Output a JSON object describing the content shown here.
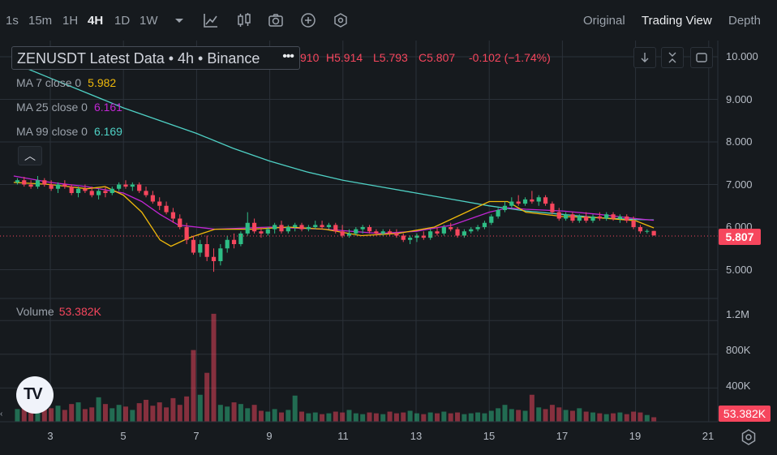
{
  "timeframes": [
    "1s",
    "15m",
    "1H",
    "4H",
    "1D",
    "1W"
  ],
  "active_timeframe": "4H",
  "views": {
    "original": "Original",
    "trading_view": "Trading View",
    "depth": "Depth"
  },
  "legend": {
    "title": "ZENUSDT Latest Data • 4h • Binance",
    "more": "•••",
    "open_partial": "910",
    "high": "H5.914",
    "low": "L5.793",
    "close": "C5.807",
    "change": "-0.102 (−1.74%)"
  },
  "ma": [
    {
      "label": "MA 7 close 0",
      "value": "5.982",
      "color": "#f0b90b"
    },
    {
      "label": "MA 25 close 0",
      "value": "6.161",
      "color": "#c026d3"
    },
    {
      "label": "MA 99 close 0",
      "value": "6.169",
      "color": "#4fd1c5"
    }
  ],
  "volume": {
    "label": "Volume",
    "value": "53.382K"
  },
  "price_axis": [
    "10.000",
    "9.000",
    "8.000",
    "7.000",
    "6.000",
    "5.000"
  ],
  "volume_axis": [
    "1.2M",
    "800K",
    "400K"
  ],
  "last_price": "5.807",
  "last_volume": "53.382K",
  "x_axis": [
    "3",
    "5",
    "7",
    "9",
    "11",
    "13",
    "15",
    "17",
    "19",
    "21"
  ],
  "colors": {
    "up": "#2ebd85",
    "down": "#f6465d",
    "bg": "#161a1e",
    "grid": "#2b3139"
  },
  "chart_data": {
    "type": "candlestick",
    "symbol": "ZENUSDT",
    "interval": "4h",
    "x_range": [
      2,
      21.5
    ],
    "price_range": [
      4.5,
      10.3
    ],
    "volume_range": [
      0,
      1300000
    ],
    "candles": [
      [
        7.05,
        7.15,
        7.0,
        7.1,
        150000
      ],
      [
        7.1,
        7.18,
        6.95,
        7.0,
        230000
      ],
      [
        7.0,
        7.1,
        6.9,
        6.95,
        180000
      ],
      [
        6.95,
        7.2,
        6.9,
        7.1,
        200000
      ],
      [
        7.1,
        7.15,
        6.95,
        7.0,
        170000
      ],
      [
        7.0,
        7.1,
        6.85,
        6.9,
        160000
      ],
      [
        6.9,
        7.05,
        6.8,
        7.0,
        190000
      ],
      [
        7.0,
        7.1,
        6.9,
        6.95,
        140000
      ],
      [
        6.95,
        7.0,
        6.75,
        6.8,
        210000
      ],
      [
        6.8,
        6.95,
        6.7,
        6.9,
        230000
      ],
      [
        6.9,
        7.0,
        6.8,
        6.85,
        150000
      ],
      [
        6.85,
        6.95,
        6.7,
        6.75,
        170000
      ],
      [
        6.75,
        6.9,
        6.65,
        6.85,
        290000
      ],
      [
        6.85,
        6.95,
        6.7,
        6.8,
        210000
      ],
      [
        6.8,
        6.95,
        6.75,
        6.9,
        160000
      ],
      [
        6.9,
        7.05,
        6.85,
        7.0,
        200000
      ],
      [
        7.0,
        7.1,
        6.9,
        6.95,
        180000
      ],
      [
        6.95,
        7.05,
        6.85,
        7.0,
        140000
      ],
      [
        7.0,
        7.05,
        6.8,
        6.85,
        220000
      ],
      [
        6.85,
        6.95,
        6.7,
        6.75,
        260000
      ],
      [
        6.75,
        6.85,
        6.55,
        6.6,
        190000
      ],
      [
        6.6,
        6.7,
        6.4,
        6.5,
        230000
      ],
      [
        6.5,
        6.6,
        6.3,
        6.35,
        170000
      ],
      [
        6.35,
        6.45,
        6.1,
        6.2,
        280000
      ],
      [
        6.2,
        6.3,
        5.95,
        6.0,
        200000
      ],
      [
        6.0,
        6.1,
        5.6,
        5.7,
        300000
      ],
      [
        5.7,
        5.8,
        5.35,
        5.4,
        850000
      ],
      [
        5.4,
        5.7,
        5.3,
        5.6,
        320000
      ],
      [
        5.6,
        5.8,
        5.2,
        5.3,
        580000
      ],
      [
        5.3,
        5.5,
        4.95,
        5.2,
        1280000
      ],
      [
        5.2,
        5.6,
        5.1,
        5.5,
        200000
      ],
      [
        5.5,
        5.8,
        5.4,
        5.7,
        180000
      ],
      [
        5.7,
        5.85,
        5.5,
        5.6,
        230000
      ],
      [
        5.6,
        5.9,
        5.55,
        5.85,
        210000
      ],
      [
        5.85,
        6.35,
        5.8,
        6.1,
        160000
      ],
      [
        6.1,
        6.2,
        5.85,
        5.9,
        200000
      ],
      [
        5.9,
        6.0,
        5.75,
        5.85,
        130000
      ],
      [
        5.85,
        6.0,
        5.8,
        5.95,
        120000
      ],
      [
        5.95,
        6.1,
        5.85,
        6.05,
        150000
      ],
      [
        6.05,
        6.15,
        5.85,
        5.9,
        110000
      ],
      [
        5.9,
        6.05,
        5.85,
        6.0,
        140000
      ],
      [
        6.0,
        6.1,
        5.9,
        6.05,
        310000
      ],
      [
        6.05,
        6.1,
        5.9,
        5.95,
        120000
      ],
      [
        5.95,
        6.05,
        5.9,
        6.0,
        100000
      ],
      [
        6.0,
        6.15,
        5.95,
        6.05,
        110000
      ],
      [
        6.05,
        6.15,
        5.95,
        6.0,
        90000
      ],
      [
        6.0,
        6.1,
        5.95,
        6.05,
        100000
      ],
      [
        6.05,
        6.1,
        5.85,
        5.9,
        120000
      ],
      [
        5.9,
        6.05,
        5.75,
        5.8,
        110000
      ],
      [
        5.8,
        5.95,
        5.75,
        5.85,
        140000
      ],
      [
        5.85,
        6.0,
        5.8,
        5.95,
        100000
      ],
      [
        5.95,
        6.05,
        5.85,
        6.0,
        90000
      ],
      [
        6.0,
        6.05,
        5.85,
        5.9,
        110000
      ],
      [
        5.9,
        5.95,
        5.8,
        5.85,
        100000
      ],
      [
        5.85,
        5.95,
        5.8,
        5.9,
        90000
      ],
      [
        5.9,
        5.95,
        5.8,
        5.85,
        120000
      ],
      [
        5.85,
        5.95,
        5.75,
        5.8,
        100000
      ],
      [
        5.8,
        5.85,
        5.65,
        5.7,
        110000
      ],
      [
        5.7,
        5.8,
        5.6,
        5.75,
        130000
      ],
      [
        5.75,
        5.85,
        5.65,
        5.8,
        100000
      ],
      [
        5.8,
        5.9,
        5.7,
        5.75,
        90000
      ],
      [
        5.75,
        5.95,
        5.7,
        5.9,
        110000
      ],
      [
        5.9,
        6.0,
        5.8,
        5.85,
        100000
      ],
      [
        5.85,
        6.05,
        5.8,
        6.0,
        120000
      ],
      [
        6.0,
        6.1,
        5.9,
        5.95,
        100000
      ],
      [
        5.95,
        6.0,
        5.75,
        5.8,
        110000
      ],
      [
        5.8,
        5.95,
        5.75,
        5.9,
        90000
      ],
      [
        5.9,
        6.0,
        5.85,
        5.95,
        100000
      ],
      [
        5.95,
        6.05,
        5.9,
        6.0,
        110000
      ],
      [
        6.0,
        6.15,
        5.95,
        6.1,
        100000
      ],
      [
        6.1,
        6.3,
        6.05,
        6.25,
        130000
      ],
      [
        6.25,
        6.45,
        6.2,
        6.4,
        160000
      ],
      [
        6.4,
        6.6,
        6.35,
        6.5,
        200000
      ],
      [
        6.5,
        6.7,
        6.45,
        6.6,
        150000
      ],
      [
        6.6,
        6.75,
        6.5,
        6.55,
        140000
      ],
      [
        6.55,
        6.7,
        6.5,
        6.65,
        130000
      ],
      [
        6.65,
        6.85,
        6.55,
        6.6,
        320000
      ],
      [
        6.6,
        6.75,
        6.5,
        6.7,
        170000
      ],
      [
        6.7,
        6.75,
        6.5,
        6.55,
        150000
      ],
      [
        6.55,
        6.6,
        6.3,
        6.35,
        200000
      ],
      [
        6.35,
        6.45,
        6.15,
        6.2,
        170000
      ],
      [
        6.2,
        6.35,
        6.15,
        6.3,
        140000
      ],
      [
        6.3,
        6.35,
        6.1,
        6.15,
        130000
      ],
      [
        6.15,
        6.3,
        6.1,
        6.25,
        160000
      ],
      [
        6.25,
        6.35,
        6.1,
        6.15,
        120000
      ],
      [
        6.15,
        6.3,
        6.1,
        6.25,
        110000
      ],
      [
        6.25,
        6.35,
        6.15,
        6.2,
        100000
      ],
      [
        6.2,
        6.35,
        6.15,
        6.3,
        90000
      ],
      [
        6.3,
        6.35,
        6.15,
        6.2,
        100000
      ],
      [
        6.2,
        6.3,
        6.1,
        6.25,
        110000
      ],
      [
        6.25,
        6.3,
        6.1,
        6.15,
        90000
      ],
      [
        6.15,
        6.25,
        5.95,
        6.0,
        120000
      ],
      [
        6.0,
        6.05,
        5.85,
        5.9,
        110000
      ],
      [
        5.9,
        5.95,
        5.85,
        5.91,
        80000
      ],
      [
        5.91,
        5.914,
        5.793,
        5.807,
        53382
      ]
    ],
    "ma7": [
      [
        2,
        7.05
      ],
      [
        3,
        7.0
      ],
      [
        4,
        6.9
      ],
      [
        4.5,
        6.95
      ],
      [
        5,
        6.75
      ],
      [
        5.5,
        6.35
      ],
      [
        6,
        5.7
      ],
      [
        6.3,
        5.55
      ],
      [
        6.8,
        5.75
      ],
      [
        7.5,
        5.95
      ],
      [
        8.5,
        5.95
      ],
      [
        9.5,
        6.0
      ],
      [
        10.5,
        5.95
      ],
      [
        11.5,
        5.8
      ],
      [
        12.5,
        5.85
      ],
      [
        13.5,
        6.0
      ],
      [
        14.5,
        6.4
      ],
      [
        15,
        6.6
      ],
      [
        15.5,
        6.6
      ],
      [
        16,
        6.35
      ],
      [
        17,
        6.25
      ],
      [
        18,
        6.22
      ],
      [
        19,
        6.15
      ],
      [
        19.5,
        5.98
      ]
    ],
    "ma25": [
      [
        2,
        7.2
      ],
      [
        3,
        7.05
      ],
      [
        4,
        6.95
      ],
      [
        5,
        6.8
      ],
      [
        5.5,
        6.6
      ],
      [
        6,
        6.3
      ],
      [
        6.5,
        6.05
      ],
      [
        7.5,
        5.95
      ],
      [
        9,
        6.0
      ],
      [
        10.5,
        5.95
      ],
      [
        12,
        5.85
      ],
      [
        13,
        5.9
      ],
      [
        14,
        6.05
      ],
      [
        15,
        6.35
      ],
      [
        15.5,
        6.45
      ],
      [
        16,
        6.42
      ],
      [
        17,
        6.38
      ],
      [
        18,
        6.3
      ],
      [
        19,
        6.2
      ],
      [
        19.5,
        6.16
      ]
    ],
    "ma99": [
      [
        2,
        9.85
      ],
      [
        3,
        9.5
      ],
      [
        4,
        9.15
      ],
      [
        5,
        8.8
      ],
      [
        6,
        8.5
      ],
      [
        7,
        8.2
      ],
      [
        8,
        7.85
      ],
      [
        9,
        7.55
      ],
      [
        10,
        7.3
      ],
      [
        11,
        7.1
      ],
      [
        12,
        6.95
      ],
      [
        13,
        6.8
      ],
      [
        14,
        6.65
      ],
      [
        15,
        6.5
      ],
      [
        16,
        6.38
      ],
      [
        17,
        6.3
      ],
      [
        18,
        6.22
      ],
      [
        19,
        6.18
      ],
      [
        19.5,
        6.17
      ]
    ]
  }
}
